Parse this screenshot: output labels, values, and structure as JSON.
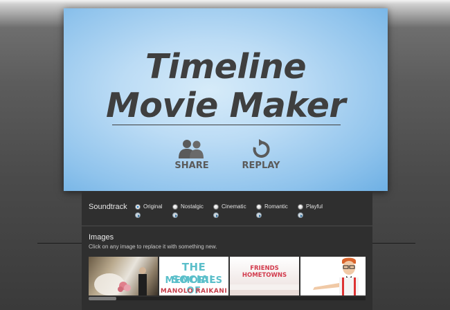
{
  "header": {
    "title_line1": "Timeline",
    "title_line2": "Movie Maker",
    "actions": [
      {
        "label": "SHARE",
        "icon": "people-icon"
      },
      {
        "label": "REPLAY",
        "icon": "replay-icon"
      }
    ]
  },
  "soundtrack": {
    "label": "Soundtrack",
    "selected": "Original",
    "options": [
      {
        "label": "Original"
      },
      {
        "label": "Nostalgic"
      },
      {
        "label": "Cinematic"
      },
      {
        "label": "Romantic"
      },
      {
        "label": "Playful"
      }
    ]
  },
  "images": {
    "label": "Images",
    "hint": "Click on any image to replace it with something new.",
    "thumbnails": [
      {
        "name": "wedding-photo"
      },
      {
        "name": "social-memories",
        "line1": "THE  SOCIAL",
        "line2": "MEMORIES  OF",
        "line3": "MANOLO RAIKANI"
      },
      {
        "name": "friends-hometowns",
        "text": "FRIENDS HOMETOWNS"
      },
      {
        "name": "man-with-suspenders"
      }
    ]
  },
  "colors": {
    "hero_blue": "#8fc3ec",
    "panel_bg": "#2f2f2f",
    "selected_radio": "#2c7fc0",
    "social_teal": "#5bbfca",
    "friends_red": "#d23a4c"
  }
}
